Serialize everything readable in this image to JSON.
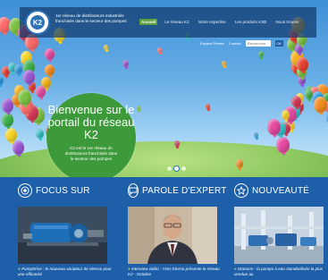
{
  "header": {
    "logo_text": "K2",
    "tagline": "1er réseau de distributeurs industriels franchisés dans le secteur des pompes",
    "nav": [
      {
        "label": "Accueil",
        "active": true
      },
      {
        "label": "Le réseau K2",
        "active": false
      },
      {
        "label": "Notre expertise",
        "active": false
      },
      {
        "label": "Les produits KSB",
        "active": false
      },
      {
        "label": "Nous trouver",
        "active": false
      }
    ],
    "utility": {
      "link1": "Espace Presse",
      "link2": "Contact",
      "search_placeholder": "Rechercher",
      "search_go": "OK"
    }
  },
  "hero": {
    "welcome_title": "Bienvenue sur le portail du réseau K2",
    "welcome_text": "K2 est le 1er réseau de distributeurs franchisés dans le secteur des pompes",
    "slide_count": 3,
    "active_slide": 2
  },
  "sections": [
    {
      "title": "FOCUS SUR",
      "icon": "target-icon",
      "caption": "PumpDrive : le nouveau variateur de vitesse pour une efficacité"
    },
    {
      "title": "PAROLE D'EXPERT",
      "icon": "speech-bubble-icon",
      "caption": "Interview vidéo : Yves Eterno présente le réseau K2 - Octobre"
    },
    {
      "title": "NOUVEAUTÉ",
      "icon": "star-icon",
      "caption": "Etanorm : la pompe à eau standardisée la plus vendue au"
    }
  ],
  "colors": {
    "brand_blue": "#1d5fa8",
    "accent_green": "#3d9a3b",
    "nav_active": "#5aa13d"
  }
}
